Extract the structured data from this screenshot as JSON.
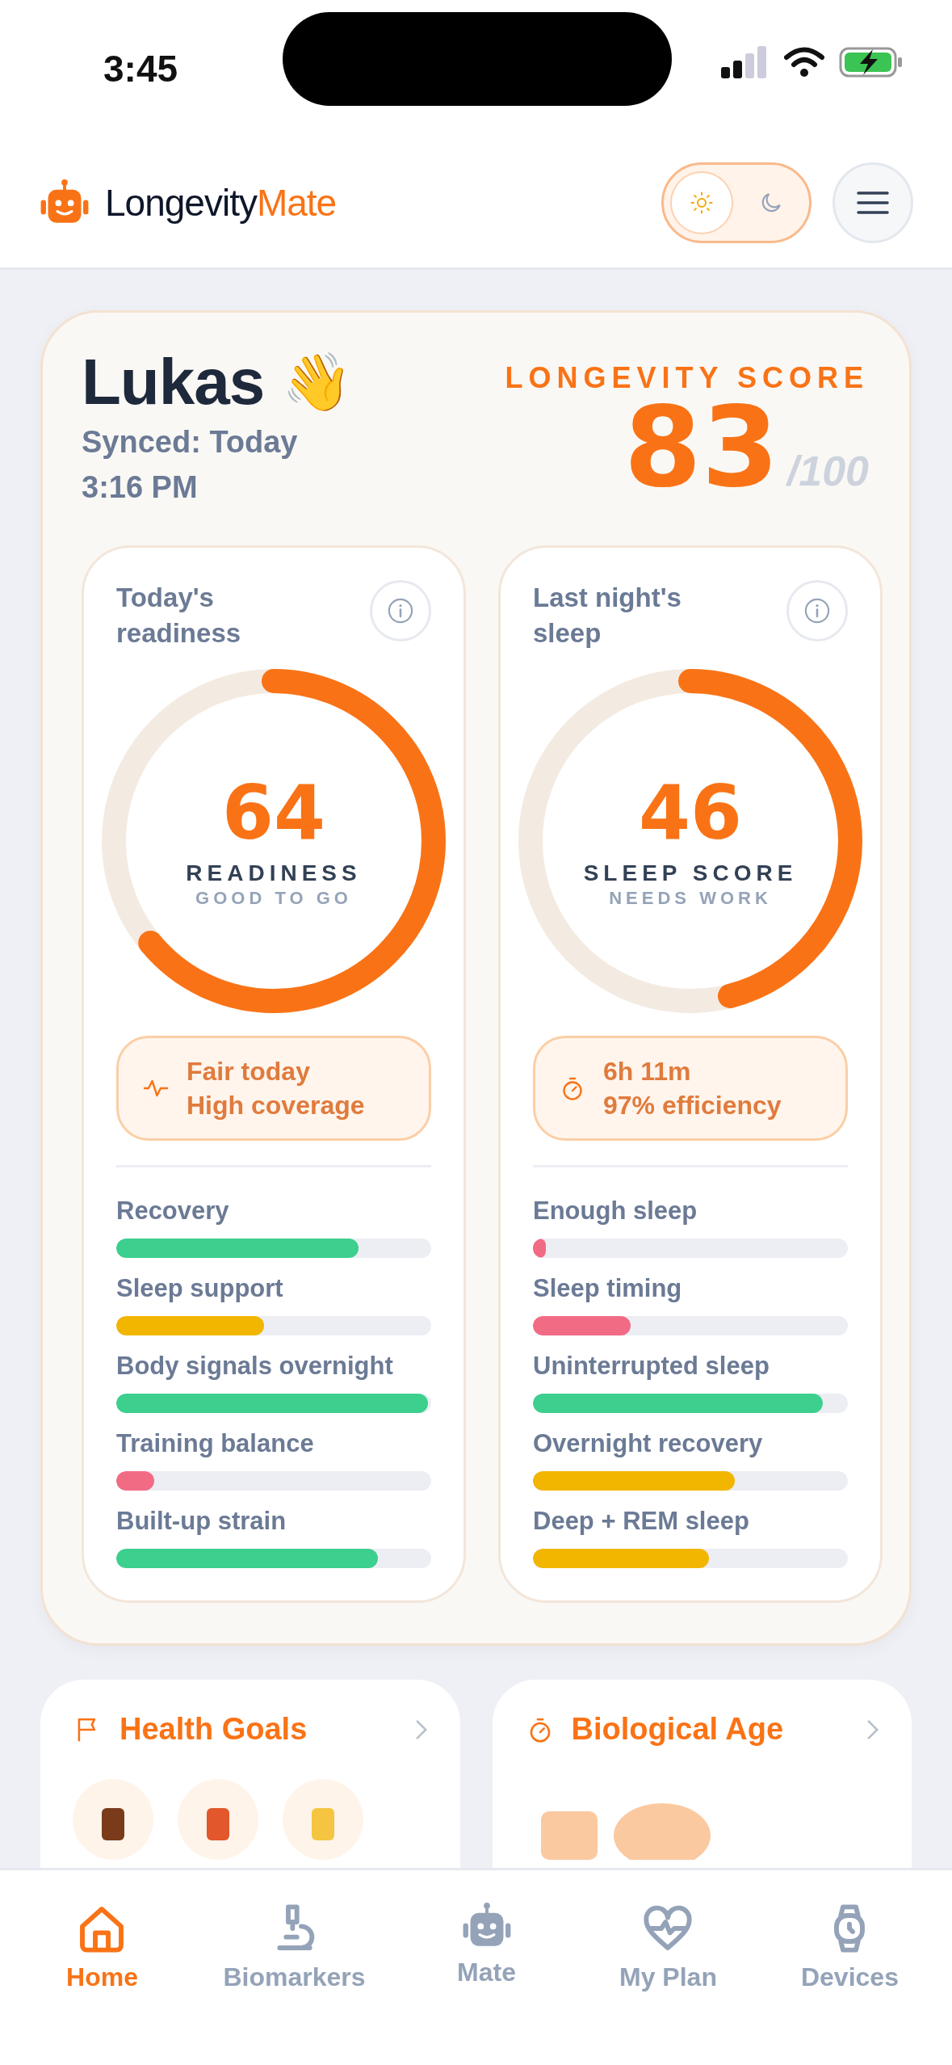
{
  "status_bar": {
    "time": "3:45"
  },
  "header": {
    "logo": {
      "part_1": "Longevity",
      "part_2": "Mate"
    },
    "theme_toggle": [
      {
        "kind": "light",
        "selected": true
      },
      {
        "kind": "dark",
        "selected": false
      }
    ]
  },
  "summary": {
    "name": "Lukas",
    "emoji": "👋",
    "synced": "Synced: Today",
    "synced_time": "3:16 PM",
    "score_label": "LONGEVITY SCORE",
    "score": "83",
    "score_max": "/100"
  },
  "panels": [
    {
      "kind": "readiness",
      "title": "Today's readiness",
      "level": 0.64,
      "value": "64",
      "label": "READINESS",
      "sublabel": "GOOD TO GO",
      "note": [
        "Fair today",
        "High coverage"
      ],
      "factors": [
        {
          "name": "Recovery",
          "level": 0.77,
          "color": "#3ccf8e"
        },
        {
          "name": "Sleep support",
          "level": 0.47,
          "color": "#f2b600"
        },
        {
          "name": "Body signals overnight",
          "level": 0.99,
          "color": "#3ccf8e"
        },
        {
          "name": "Training balance",
          "level": 0.12,
          "color": "#f26b85"
        },
        {
          "name": "Built-up strain",
          "level": 0.83,
          "color": "#3ccf8e"
        }
      ]
    },
    {
      "kind": "sleep",
      "title": "Last night's sleep",
      "level": 0.46,
      "value": "46",
      "label": "SLEEP SCORE",
      "sublabel": "NEEDS WORK",
      "note": [
        "6h 11m",
        "97% efficiency"
      ],
      "factors": [
        {
          "name": "Enough sleep",
          "level": 0.04,
          "color": "#f26b85"
        },
        {
          "name": "Sleep timing",
          "level": 0.31,
          "color": "#f26b85"
        },
        {
          "name": "Uninterrupted sleep",
          "level": 0.92,
          "color": "#3ccf8e"
        },
        {
          "name": "Overnight recovery",
          "level": 0.64,
          "color": "#f2b600"
        },
        {
          "name": "Deep + REM sleep",
          "level": 0.56,
          "color": "#f2b600"
        }
      ]
    }
  ],
  "cards": [
    {
      "kind": "goals",
      "title": "Health Goals"
    },
    {
      "kind": "age",
      "title": "Biological Age"
    }
  ],
  "tab_bar": [
    {
      "kind": "home",
      "label": "Home",
      "selected": true
    },
    {
      "kind": "biomarkers",
      "label": "Biomarkers",
      "selected": false
    },
    {
      "kind": "mate",
      "label": "Mate",
      "selected": false
    },
    {
      "kind": "plan",
      "label": "My Plan",
      "selected": false
    },
    {
      "kind": "devices",
      "label": "Devices",
      "selected": false
    }
  ]
}
